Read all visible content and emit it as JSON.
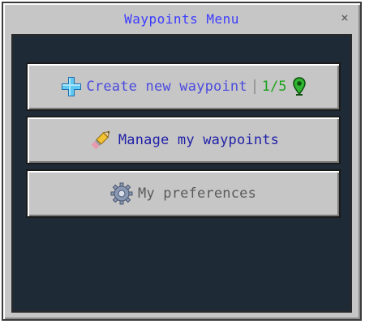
{
  "window": {
    "title": "Waypoints Menu",
    "close_label": "×"
  },
  "buttons": [
    {
      "label": "Create new waypoint",
      "counter": "1/5",
      "icon": "plus-icon",
      "secondary_icon": "map-pin-icon"
    },
    {
      "label": "Manage my waypoints",
      "icon": "pencil-icon"
    },
    {
      "label": "My preferences",
      "icon": "gear-icon"
    }
  ],
  "colors": {
    "title": "#3b3bff",
    "create_label": "#4a4adf",
    "manage_label": "#1f1fa8",
    "preferences_label": "#5a5a5a",
    "counter": "#1aa31a",
    "content_bg": "#1f2a37",
    "panel_bg": "#c6c6c6"
  }
}
